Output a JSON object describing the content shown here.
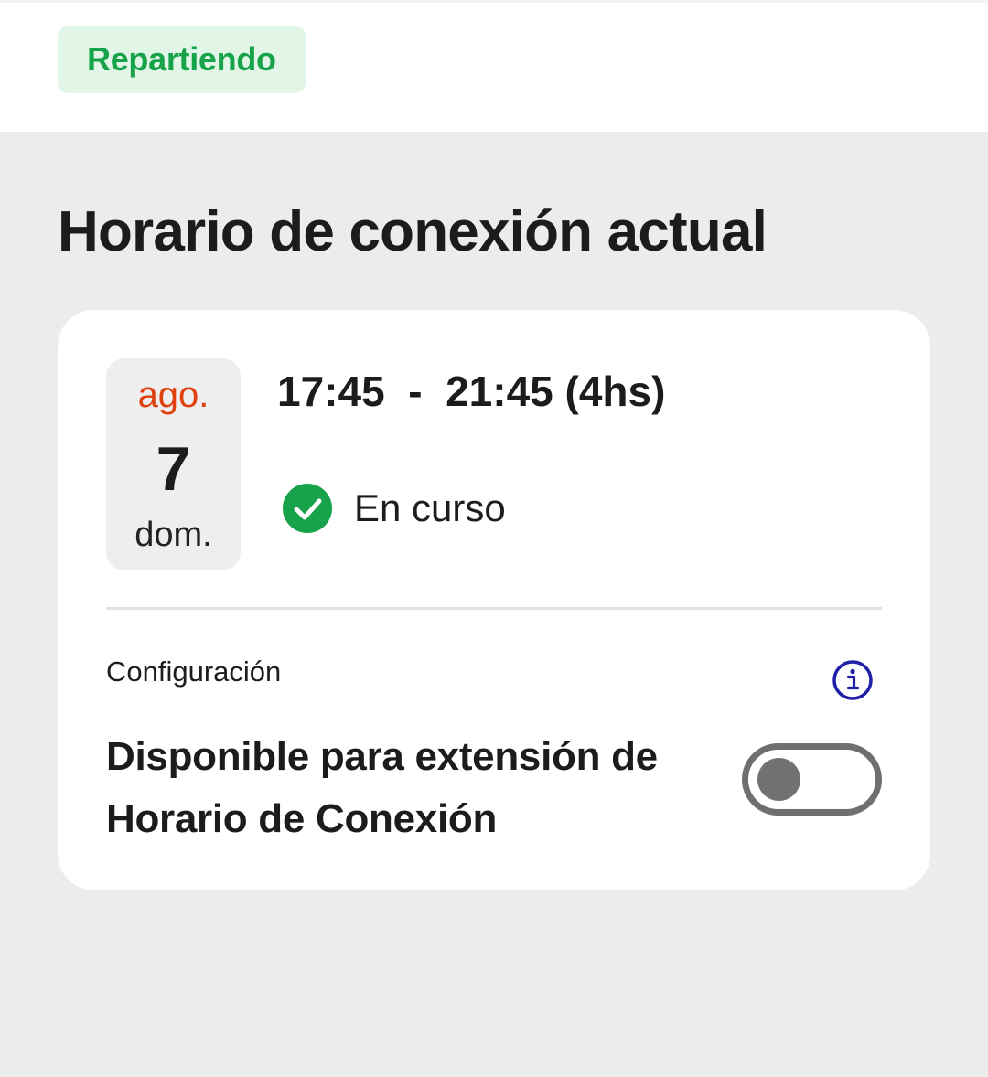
{
  "header": {
    "status_label": "Repartiendo"
  },
  "section": {
    "title": "Horario de conexión actual"
  },
  "shift": {
    "month": "ago.",
    "day": "7",
    "weekday": "dom.",
    "time_range": "17:45  -  21:45 (4hs)",
    "status": "En curso"
  },
  "config": {
    "label": "Configuración",
    "toggle_title": "Disponible para extensión de Horario de Conexión",
    "toggle_on": false
  },
  "colors": {
    "status_green": "#17a34a",
    "status_pill_bg": "#e2f6e7",
    "month_accent": "#e0400f",
    "info_icon": "#1f1fa8",
    "toggle_off": "#6f6f6f"
  },
  "icons": {
    "status": "check-circle-icon",
    "info": "info-icon"
  }
}
